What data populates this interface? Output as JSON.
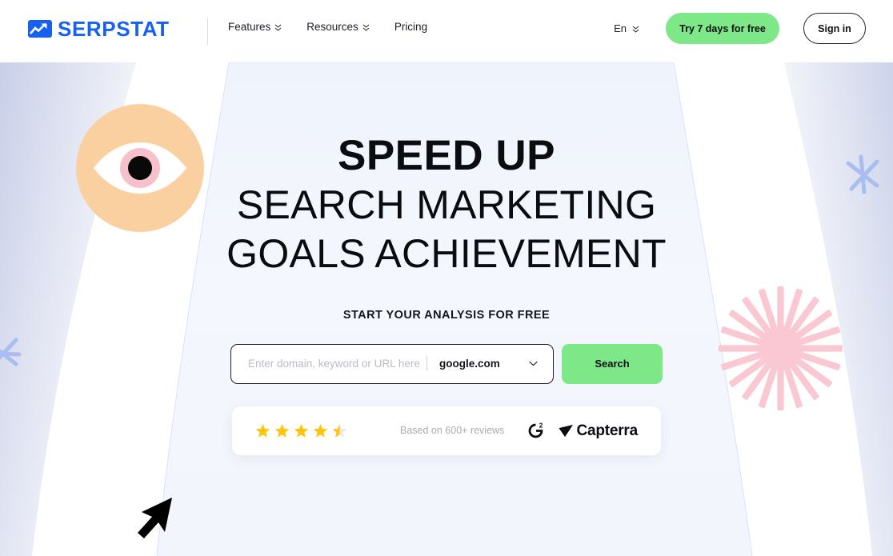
{
  "header": {
    "logo_text": "SERPSTAT",
    "logo_icon": "serpstat-chart-arrow-logo",
    "nav": [
      {
        "label": "Features",
        "has_dropdown": true,
        "icon": "double-chevron-down-icon"
      },
      {
        "label": "Resources",
        "has_dropdown": true,
        "icon": "double-chevron-down-icon"
      },
      {
        "label": "Pricing",
        "has_dropdown": false,
        "icon": ""
      }
    ],
    "language": {
      "label": "En",
      "icon": "double-chevron-down-icon"
    },
    "trial_button": "Try 7 days for free",
    "signin_button": "Sign in"
  },
  "hero": {
    "headline_line1": "SPEED UP",
    "headline_line2": "SEARCH MARKETING",
    "headline_line3": "GOALS ACHIEVEMENT",
    "subheadline": "START YOUR ANALYSIS FOR FREE",
    "search": {
      "placeholder": "Enter domain, keyword or URL here",
      "value": "",
      "engine": "google.com",
      "engine_chevron_icon": "chevron-down-icon",
      "button_label": "Search"
    },
    "reviews": {
      "rating": 4.5,
      "max_rating": 5,
      "star_icon": "star-icon",
      "text": "Based on 600+ reviews",
      "badges": [
        {
          "name": "G2",
          "icon": "g2-logo-icon"
        },
        {
          "name": "Capterra",
          "icon": "capterra-logo-icon"
        }
      ]
    }
  },
  "decorations": [
    {
      "name": "eye-illustration",
      "icon": "eye-icon"
    },
    {
      "name": "starburst-illustration",
      "icon": "starburst-icon"
    },
    {
      "name": "asterisk-right",
      "icon": "asterisk-icon"
    },
    {
      "name": "asterisk-left",
      "icon": "asterisk-icon"
    },
    {
      "name": "cursor-arrow-illustration",
      "icon": "cursor-arrow-icon"
    }
  ],
  "colors": {
    "brand_blue": "#1660f3",
    "accent_green": "#7ee787",
    "star_yellow": "#ffc312",
    "eye_orange": "#fbd0a0",
    "eye_pink": "#f7c1cb",
    "starburst_pink": "#f9c8d2",
    "asterisk_blue": "#a8bdf0",
    "hero_panel": "#f4f7fd",
    "text_dark": "#0b0c10",
    "text_muted": "#a8abb3"
  }
}
